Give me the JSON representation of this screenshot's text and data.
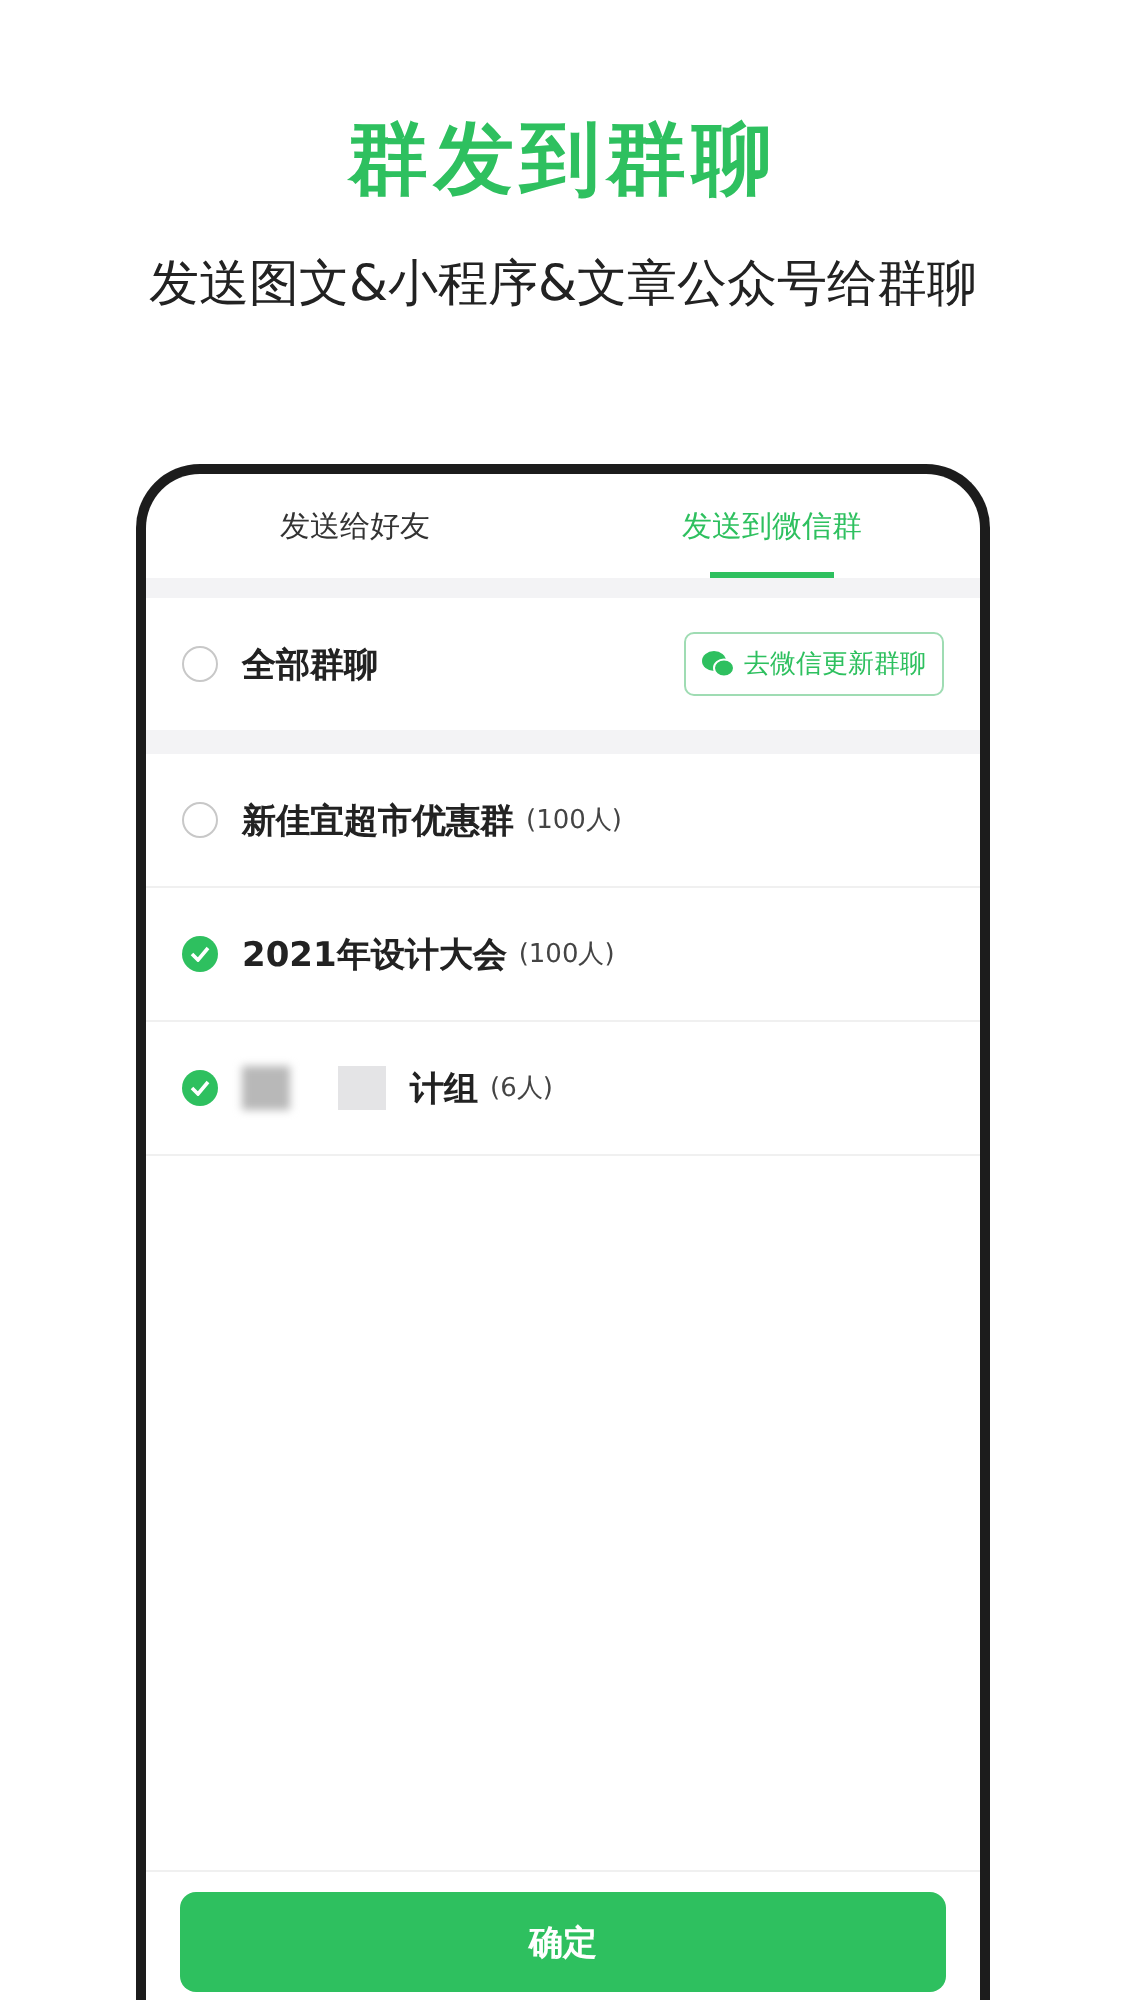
{
  "headline": "群发到群聊",
  "subtitle": "发送图文&小程序&文章公众号给群聊",
  "tabs": [
    {
      "label": "发送给好友",
      "selected": false
    },
    {
      "label": "发送到微信群",
      "selected": true
    }
  ],
  "all_groups": {
    "label": "全部群聊",
    "checked": false,
    "update_button": "去微信更新群聊"
  },
  "groups": [
    {
      "name": "新佳宜超市优惠群",
      "count": "(100人)",
      "checked": false,
      "redacted": false
    },
    {
      "name": "2021年设计大会",
      "count": "(100人)",
      "checked": true,
      "redacted": false
    },
    {
      "name": "计组",
      "count": "(6人)",
      "checked": true,
      "redacted": true
    }
  ],
  "confirm_button": "确定"
}
